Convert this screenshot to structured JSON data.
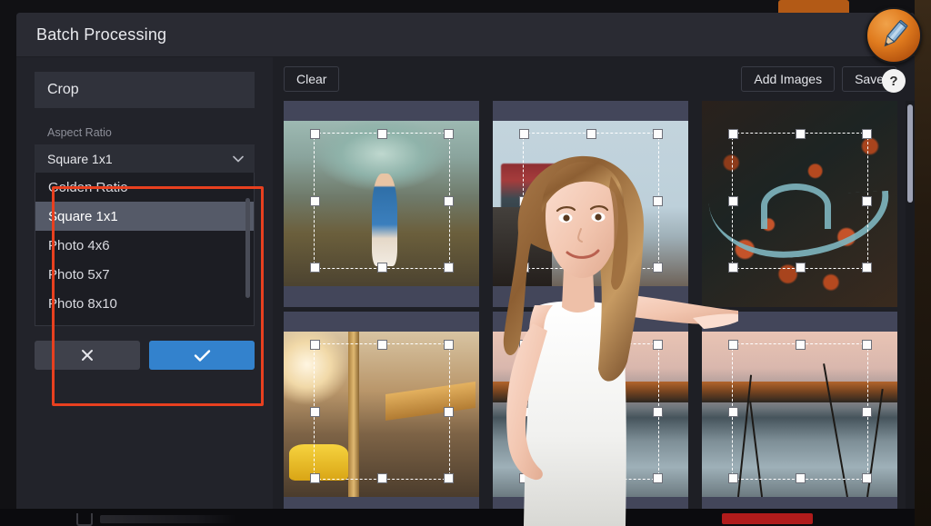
{
  "window": {
    "title": "Batch Processing"
  },
  "logo": {
    "name": "pencil-logo",
    "help_label": "?"
  },
  "sidebar": {
    "tool_title": "Crop",
    "aspect_ratio": {
      "label": "Aspect Ratio",
      "selected": "Square 1x1",
      "chevron": "⌄",
      "options": [
        "Golden Ratio",
        "Square 1x1",
        "Photo 4x6",
        "Photo 5x7",
        "Photo 8x10"
      ],
      "selected_index": 1
    },
    "actions": {
      "cancel_label": "✕",
      "confirm_label": "✓"
    }
  },
  "toolbar": {
    "clear_label": "Clear",
    "add_images_label": "Add Images",
    "save_label": "Save"
  },
  "grid": {
    "tiles": [
      {
        "name": "thumbnail-greenhouse",
        "art": "ph-greenhouse"
      },
      {
        "name": "thumbnail-train",
        "art": "ph-train"
      },
      {
        "name": "thumbnail-aerial-forest",
        "art": "ph-aerial"
      },
      {
        "name": "thumbnail-city-street",
        "art": "ph-street"
      },
      {
        "name": "thumbnail-lake-sunset",
        "art": "ph-lake"
      },
      {
        "name": "thumbnail-lake-reflection",
        "art": "ph-lake"
      }
    ]
  },
  "colors": {
    "accent_blue": "#3382cd",
    "annotation_red": "#e8401f",
    "brand_orange": "#e07b1e",
    "dialog_bg": "#24252c",
    "tile_bg": "#43465a"
  }
}
